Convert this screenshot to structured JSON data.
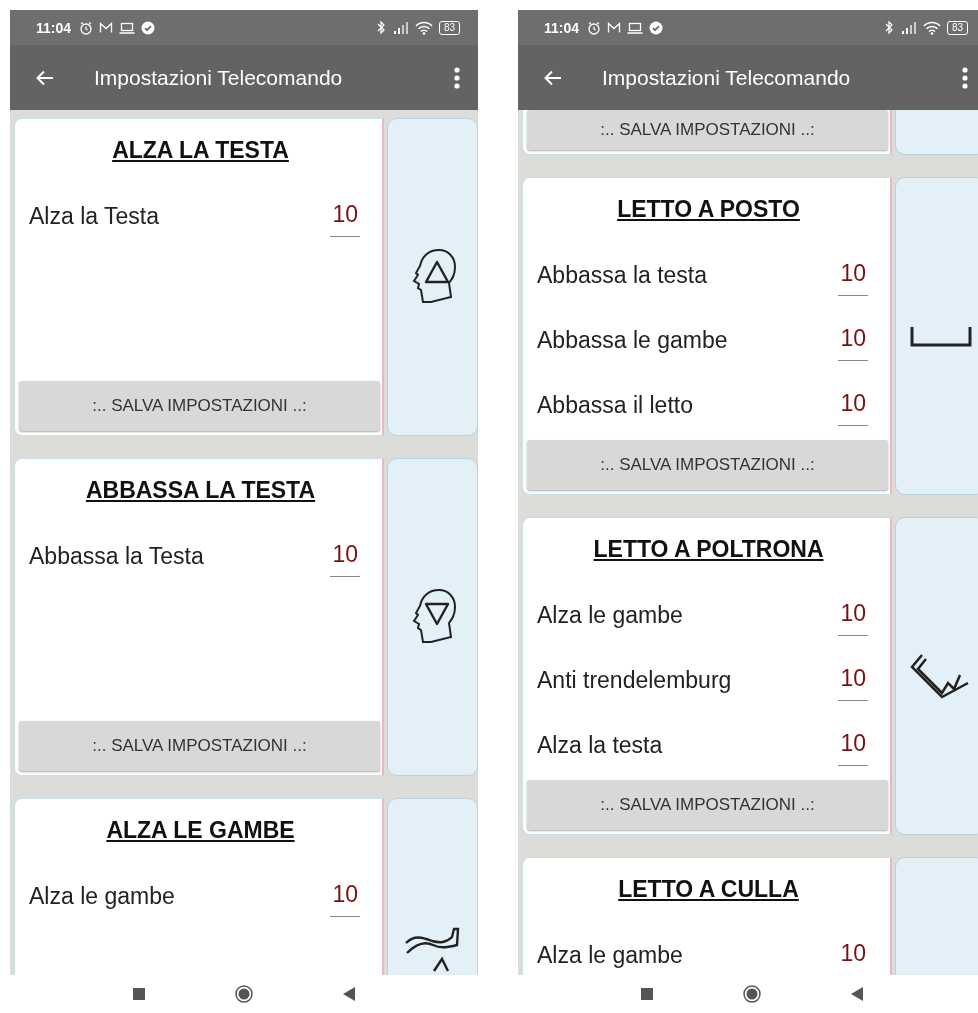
{
  "phones": [
    {
      "status_bar": {
        "time": "11:04",
        "battery": "83"
      },
      "app_bar": {
        "title": "Impostazioni Telecomando"
      },
      "cards": [
        {
          "kind": "full",
          "title": "ALZA LA TESTA",
          "rows": [
            {
              "label": "Alza la Testa",
              "value": "10"
            }
          ],
          "save_button": ":.. SALVA IMPOSTAZIONI ..:"
        },
        {
          "kind": "full",
          "title": "ABBASSA LA TESTA",
          "rows": [
            {
              "label": "Abbassa la Testa",
              "value": "10"
            }
          ],
          "save_button": ":.. SALVA IMPOSTAZIONI ..:"
        },
        {
          "kind": "full",
          "title": "ALZA LE GAMBE",
          "rows": [
            {
              "label": "Alza le gambe",
              "value": "10"
            }
          ]
        }
      ]
    },
    {
      "status_bar": {
        "time": "11:04",
        "battery": "83"
      },
      "app_bar": {
        "title": "Impostazioni Telecomando"
      },
      "cards": [
        {
          "kind": "partial",
          "save_button": ":.. SALVA IMPOSTAZIONI ..:"
        },
        {
          "kind": "full",
          "title": "LETTO A POSTO",
          "rows": [
            {
              "label": "Abbassa la testa",
              "value": "10"
            },
            {
              "label": "Abbassa le gambe",
              "value": "10"
            },
            {
              "label": "Abbassa il letto",
              "value": "10"
            }
          ],
          "save_button": ":.. SALVA IMPOSTAZIONI ..:"
        },
        {
          "kind": "full",
          "title": "LETTO A POLTRONA",
          "rows": [
            {
              "label": "Alza le gambe",
              "value": "10"
            },
            {
              "label": "Anti trendelemburg",
              "value": "10"
            },
            {
              "label": "Alza la testa",
              "value": "10"
            }
          ],
          "save_button": ":.. SALVA IMPOSTAZIONI ..:"
        },
        {
          "kind": "full",
          "title": "LETTO A CULLA",
          "rows": [
            {
              "label": "Alza le gambe",
              "value": "10"
            }
          ]
        }
      ]
    }
  ]
}
